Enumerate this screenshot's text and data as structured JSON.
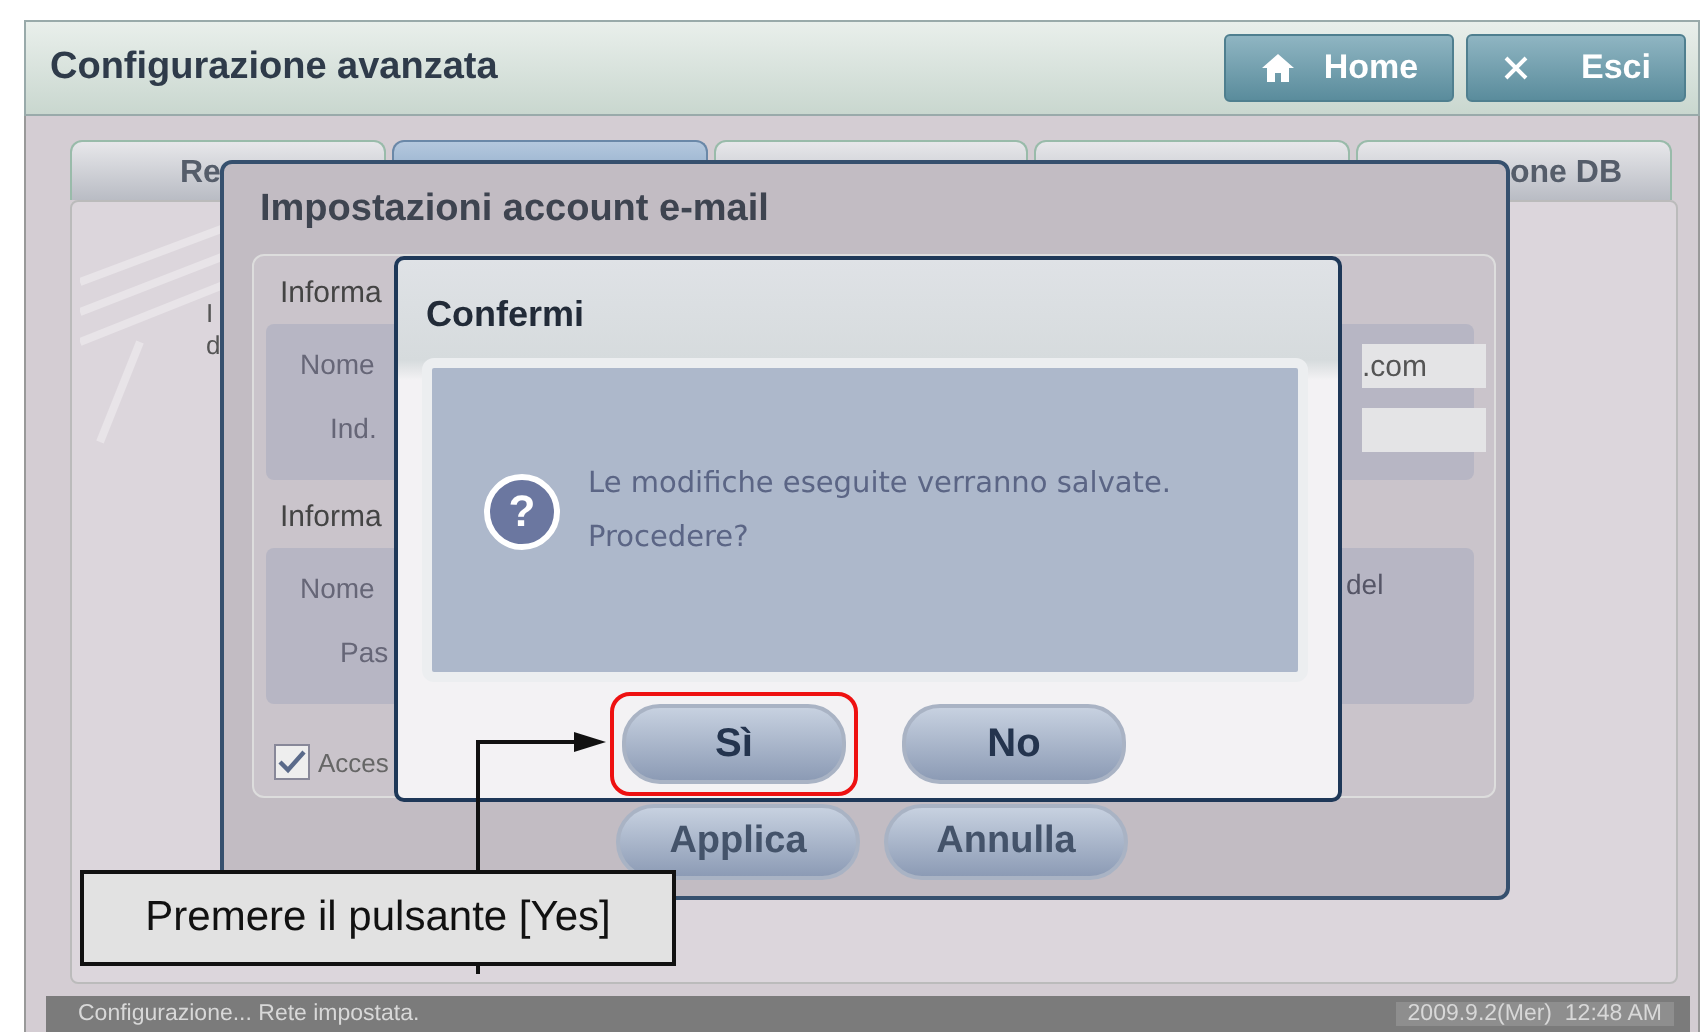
{
  "window": {
    "title": "Configurazione avanzata"
  },
  "header_buttons": [
    {
      "kind": "home",
      "label": "Home"
    },
    {
      "kind": "exit",
      "label": "Esci"
    }
  ],
  "tabs": [
    {
      "label": "Re",
      "selected": false
    },
    {
      "selected": true
    },
    {
      "selected": false
    },
    {
      "selected": false
    },
    {
      "label": "one DB",
      "selected": false
    }
  ],
  "background_panel": {
    "partial_text": [
      "I",
      "d"
    ]
  },
  "email_dialog": {
    "title": "Impostazioni account e-mail",
    "sections": [
      {
        "heading": "Informa",
        "fields": [
          {
            "label": "Nome",
            "value": ".com"
          },
          {
            "label": "Ind."
          }
        ]
      },
      {
        "heading": "Informa",
        "fields": [
          {
            "label": "Nome"
          },
          {
            "label": "Pas"
          }
        ],
        "note": "del"
      }
    ],
    "checkbox": {
      "label": "Acces",
      "checked": true
    },
    "buttons": [
      "Applica",
      "Annulla"
    ]
  },
  "confirm_dialog": {
    "title": "Confermi",
    "icon": "?",
    "message": [
      "Le modifiche eseguite verranno salvate.",
      "Procedere?"
    ],
    "buttons": [
      {
        "label": "Sì",
        "highlighted": true
      },
      {
        "label": "No",
        "highlighted": false
      }
    ]
  },
  "callout": {
    "text": "Premere il pulsante [Yes]"
  },
  "status_bar": {
    "message": "Configurazione... Rete impostata.",
    "datetime": "2009.9.2(Mer)  12:48 AM"
  }
}
